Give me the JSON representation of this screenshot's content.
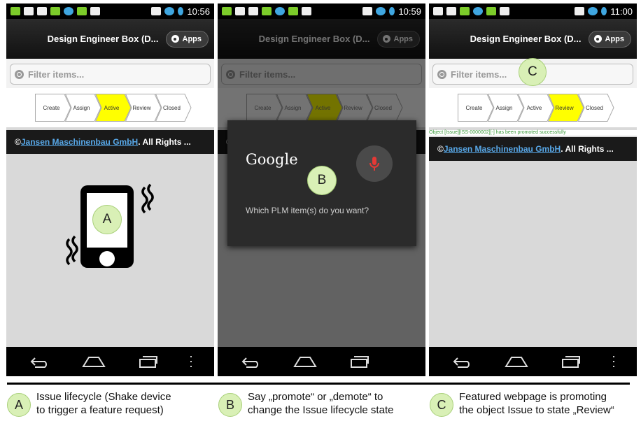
{
  "app": {
    "title": "Design Engineer Box (D...",
    "apps_label": "Apps",
    "filter_placeholder": "Filter items...",
    "footer_prefix": "© ",
    "footer_link": "Jansen Maschinenbau GmbH",
    "footer_suffix": ". All Rights ..."
  },
  "lifecycle_states": [
    "Create",
    "Assign",
    "Active",
    "Review",
    "Closed"
  ],
  "colors": {
    "highlight": "#ffff00",
    "marker_fill": "#d9f0b6",
    "link": "#58a8e8",
    "success": "#3a9a3a",
    "mic": "#e53935"
  },
  "screens": [
    {
      "time": "10:56",
      "active_state": "Active",
      "marker": "A"
    },
    {
      "time": "10:59",
      "active_state": "Active",
      "marker": "B",
      "voice": {
        "logo": "Google",
        "prompt": "Which PLM item(s) do you want?"
      }
    },
    {
      "time": "11:00",
      "active_state": "Review",
      "marker": "C",
      "message": "Object [Issue][ISS-0000002][-] has been promoted successfully"
    }
  ],
  "legend": [
    {
      "marker": "A",
      "line1": "Issue lifecycle (Shake device",
      "line2": "to trigger a feature request)"
    },
    {
      "marker": "B",
      "line1": "Say „promote“ or „demote“ to",
      "line2": "change the Issue lifecycle state"
    },
    {
      "marker": "C",
      "line1": "Featured webpage is promoting",
      "line2": "the object Issue to state „Review“"
    }
  ],
  "icons": {
    "search": "search-icon",
    "gear": "gear-icon",
    "mic": "mic-icon",
    "back": "back-icon",
    "home": "home-icon",
    "recents": "recents-icon",
    "menu": "menu-icon",
    "shake_phone": "shaking-phone-icon"
  }
}
